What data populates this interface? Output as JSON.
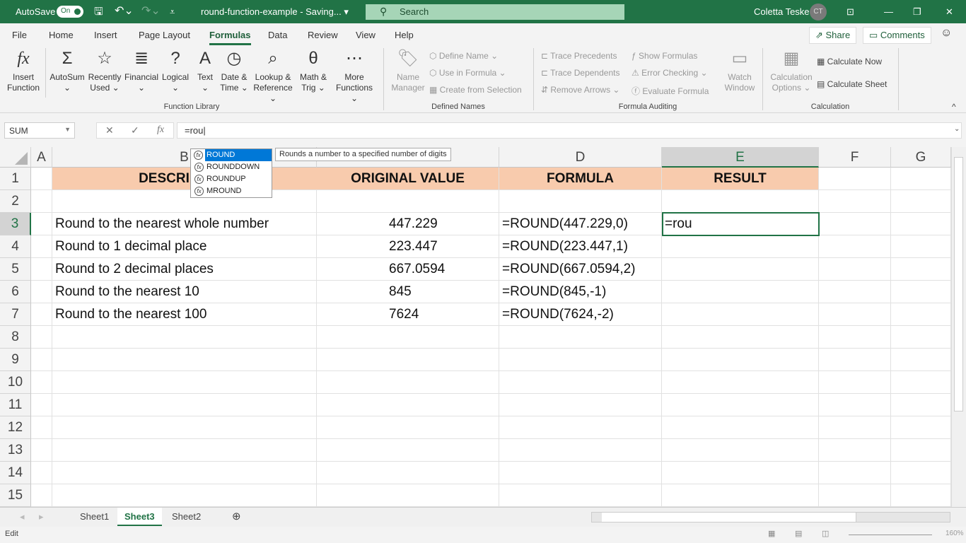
{
  "titlebar": {
    "autosave_label": "AutoSave",
    "autosave_state": "On",
    "doc_title": "round-function-example  -  Saving...",
    "search_placeholder": "Search",
    "user_name": "Coletta Teske",
    "user_initials": "CT"
  },
  "menu": {
    "tabs": [
      "File",
      "Home",
      "Insert",
      "Page Layout",
      "Formulas",
      "Data",
      "Review",
      "View",
      "Help"
    ],
    "active": "Formulas",
    "share": "Share",
    "comments": "Comments"
  },
  "ribbon": {
    "function_library": {
      "label": "Function Library",
      "buttons": [
        {
          "l1": "Insert",
          "l2": "Function",
          "icon": "fx"
        },
        {
          "l1": "AutoSum",
          "l2": "⌄",
          "icon": "Σ"
        },
        {
          "l1": "Recently",
          "l2": "Used ⌄",
          "icon": "☆"
        },
        {
          "l1": "Financial",
          "l2": "⌄",
          "icon": "≣"
        },
        {
          "l1": "Logical",
          "l2": "⌄",
          "icon": "?"
        },
        {
          "l1": "Text",
          "l2": "⌄",
          "icon": "A"
        },
        {
          "l1": "Date &",
          "l2": "Time ⌄",
          "icon": "◷"
        },
        {
          "l1": "Lookup &",
          "l2": "Reference ⌄",
          "icon": "⌕"
        },
        {
          "l1": "Math &",
          "l2": "Trig ⌄",
          "icon": "θ"
        },
        {
          "l1": "More",
          "l2": "Functions ⌄",
          "icon": "⋯"
        }
      ]
    },
    "defined_names": {
      "label": "Defined Names",
      "name_manager_l1": "Name",
      "name_manager_l2": "Manager",
      "items": [
        "Define Name ⌄",
        "Use in Formula ⌄",
        "Create from Selection"
      ]
    },
    "formula_auditing": {
      "label": "Formula Auditing",
      "left": [
        "Trace Precedents",
        "Trace Dependents",
        "Remove Arrows ⌄"
      ],
      "right": [
        "Show Formulas",
        "Error Checking ⌄",
        "Evaluate Formula"
      ],
      "watch_l1": "Watch",
      "watch_l2": "Window"
    },
    "calculation": {
      "label": "Calculation",
      "options_l1": "Calculation",
      "options_l2": "Options ⌄",
      "now": "Calculate Now",
      "sheet": "Calculate Sheet"
    }
  },
  "formula_bar": {
    "name_box": "SUM",
    "value": "=rou"
  },
  "autocomplete": {
    "items": [
      "ROUND",
      "ROUNDDOWN",
      "ROUNDUP",
      "MROUND"
    ],
    "selected": "ROUND",
    "tooltip": "Rounds a number to a specified number of digits"
  },
  "sheet": {
    "columns": [
      "A",
      "B",
      "C",
      "D",
      "E",
      "F",
      "G"
    ],
    "selected_column": "E",
    "selected_row": 3,
    "rows": [
      [
        "",
        "DESCRIPTION",
        "ORIGINAL VALUE",
        "FORMULA",
        "RESULT"
      ],
      [
        "",
        "",
        "",
        "",
        ""
      ],
      [
        "",
        "Round to the nearest whole number",
        "447.229",
        "=ROUND(447.229,0)",
        "=rou"
      ],
      [
        "",
        "Round to 1 decimal place",
        "223.447",
        "=ROUND(223.447,1)",
        ""
      ],
      [
        "",
        "Round to 2 decimal places",
        "667.0594",
        "=ROUND(667.0594,2)",
        ""
      ],
      [
        "",
        "Round to the nearest 10",
        "845",
        "=ROUND(845,-1)",
        ""
      ],
      [
        "",
        "Round to the nearest 100",
        "7624",
        "=ROUND(7624,-2)",
        ""
      ],
      [],
      [],
      [],
      [],
      [],
      [],
      [],
      []
    ],
    "header_fill": "#f8cbad"
  },
  "sheet_tabs": [
    "Sheet1",
    "Sheet3",
    "Sheet2"
  ],
  "active_sheet": "Sheet3",
  "status": {
    "mode": "Edit",
    "zoom": "160%"
  }
}
